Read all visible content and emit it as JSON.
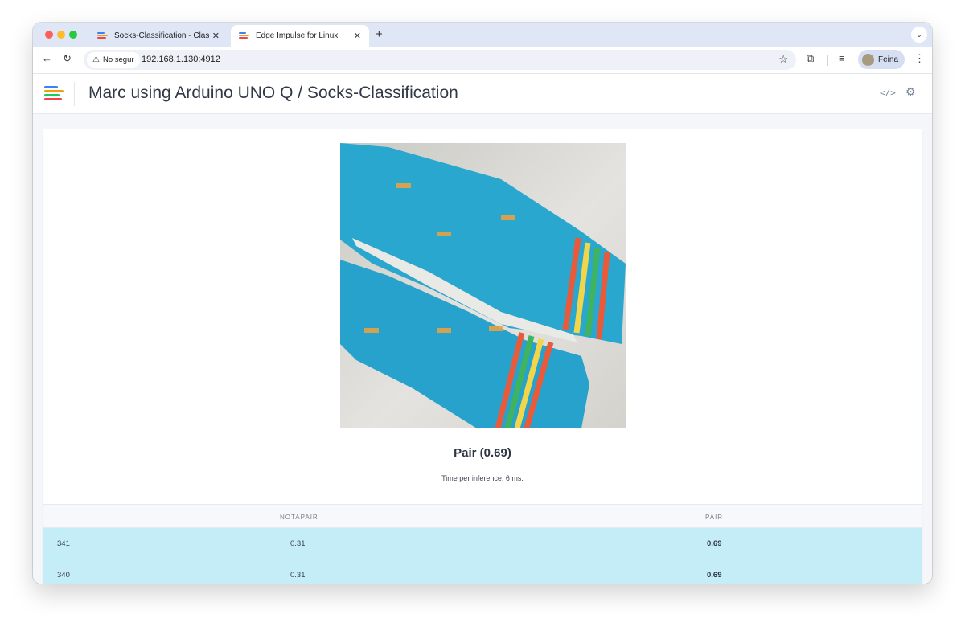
{
  "browser": {
    "tabs": [
      {
        "title": "Socks-Classification - Classification"
      },
      {
        "title": "Edge Impulse for Linux"
      }
    ],
    "new_tab_icon": "plus-icon",
    "security_label": "No segur",
    "url": "192.168.1.130:4912",
    "profile_name": "Feina"
  },
  "app": {
    "brand_colors": [
      "#3b82f6",
      "#f59e0b",
      "#22c55e",
      "#ef4444"
    ],
    "project_title": "Marc using Arduino UNO Q / Socks-Classification",
    "header_icons": [
      "code-icon",
      "gear-icon"
    ]
  },
  "classification": {
    "camera_subject": "socks",
    "result_label": "Pair (0.69)",
    "timing_text": "Time per inference: 6 ms."
  },
  "results_table": {
    "columns": [
      "",
      "NOTAPAIR",
      "PAIR"
    ],
    "rows": [
      {
        "id": "341",
        "notapair": "0.31",
        "pair": "0.69"
      },
      {
        "id": "340",
        "notapair": "0.31",
        "pair": "0.69"
      }
    ],
    "highlight_color": "#c5edf8"
  }
}
